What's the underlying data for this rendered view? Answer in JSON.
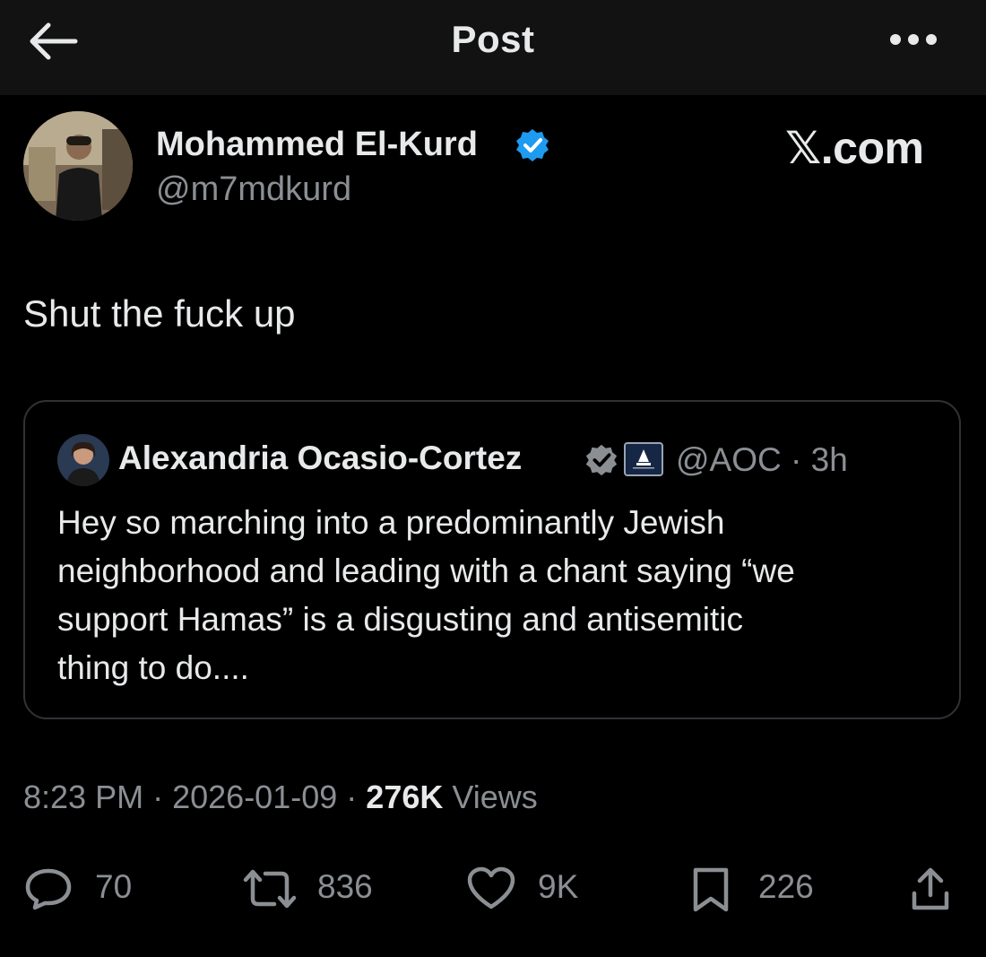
{
  "header": {
    "title": "Post",
    "back_icon": "arrow-left-icon",
    "more_icon": "more-horizontal-icon"
  },
  "post": {
    "author_name": "Mohammed El-Kurd",
    "author_handle": "@m7mdkurd",
    "watermark": "𝕏.com",
    "text": "Shut the fuck up",
    "time": "8:23 PM",
    "date": "2026-01-09",
    "views_count": "276K",
    "views_label": "Views",
    "sep": "·"
  },
  "quote": {
    "author_name": "Alexandria Ocasio-Cortez",
    "handle_time": "@AOC · 3h",
    "text_lines": [
      "Hey so marching into a predominantly Jewish",
      "neighborhood and leading with a chant saying “we",
      "support Hamas” is a disgusting and antisemitic",
      "thing to do...."
    ]
  },
  "actions": {
    "replies": "70",
    "reposts": "836",
    "likes": "9K",
    "bookmarks": "226"
  },
  "colors": {
    "background": "#000000",
    "header": "#121212",
    "text": "#e7e9ea",
    "secondary_text": "#8b8f94",
    "verified": "#1d9bf0",
    "border": "#2f3336"
  }
}
